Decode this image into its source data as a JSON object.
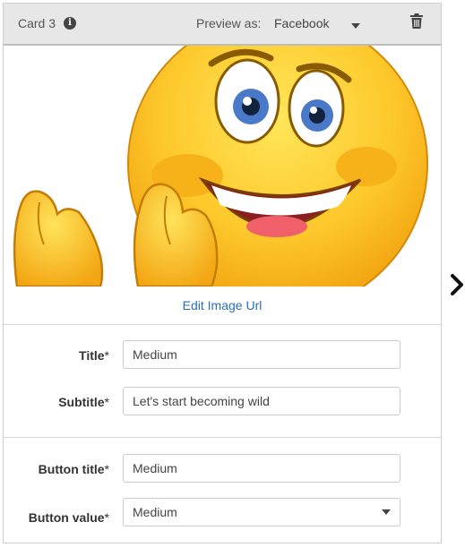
{
  "card": {
    "title": "Card 3",
    "preview_label": "Preview as:",
    "preview_value": "Facebook"
  },
  "image": {
    "edit_label": "Edit Image Url"
  },
  "fields": {
    "title": {
      "label": "Title",
      "value": "Medium"
    },
    "subtitle": {
      "label": "Subtitle",
      "value": "Let's start becoming wild"
    },
    "button_title": {
      "label": "Button title",
      "value": "Medium"
    },
    "button_value": {
      "label": "Button value",
      "value": "Medium"
    }
  },
  "required_marker": "*",
  "icons": [
    "info-icon",
    "chevron-down-icon",
    "trash-icon",
    "chevron-right-icon"
  ],
  "colors": {
    "link": "#2a6ebb",
    "header_bg": "#e7e7e7"
  }
}
